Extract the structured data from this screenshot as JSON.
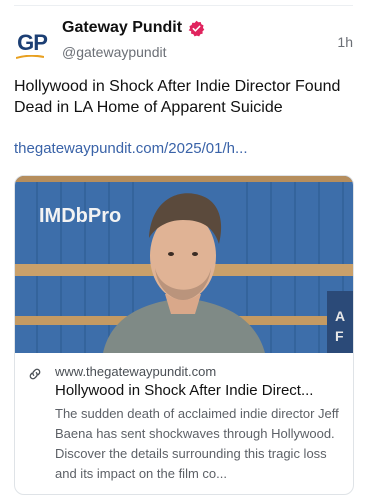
{
  "post": {
    "author_name": "Gateway Pundit",
    "author_handle": "@gatewaypundit",
    "avatar_text": "GP",
    "timestamp": "1h",
    "text": "Hollywood in Shock After Indie Director Found Dead in LA Home of Apparent Suicide",
    "link": "thegatewaypundit.com/2025/01/h..."
  },
  "card": {
    "image_watermark": "IMDbPro",
    "domain": "www.thegatewaypundit.com",
    "title": "Hollywood in Shock After Indie Direct...",
    "description": "The sudden death of acclaimed indie director Jeff Baena has sent shockwaves through Hollywood. Discover the details surrounding this tragic loss and its impact on the film co..."
  },
  "icons": {
    "verified": "verified-badge-icon",
    "link": "link-chain-icon"
  },
  "colors": {
    "link": "#3a63a8",
    "verified": "#e0245e",
    "brand": "#1c3f74"
  }
}
